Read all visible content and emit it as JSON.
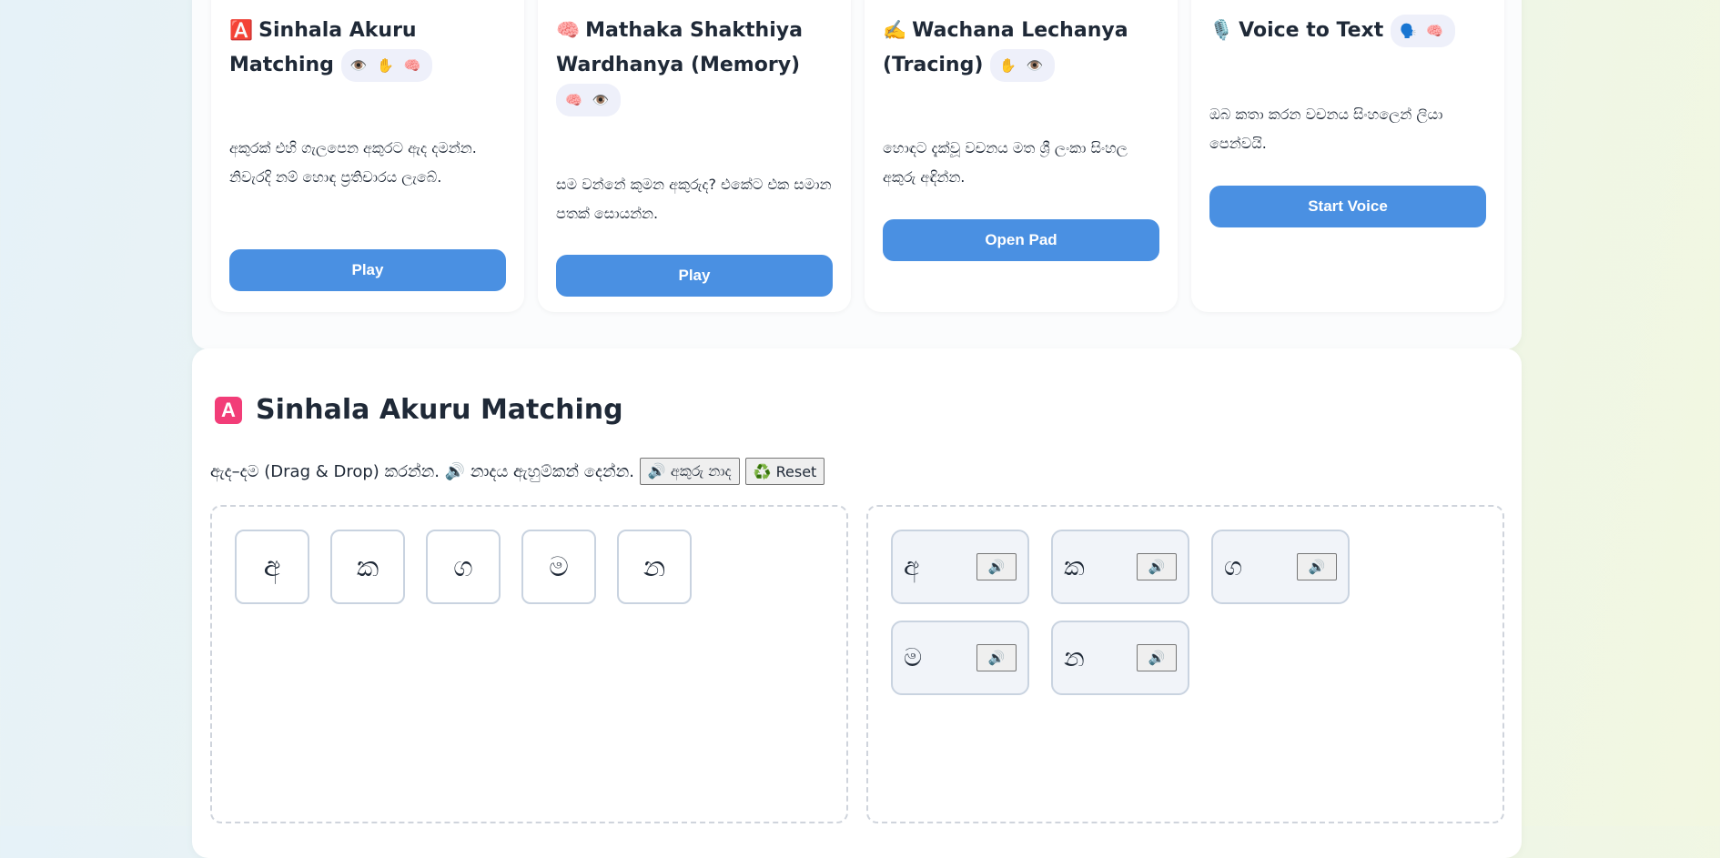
{
  "colors": {
    "accent": "#4a90e2",
    "badge_pink": "#f23d78",
    "tag_bg": "#eef0fa"
  },
  "cards": [
    {
      "icon": "🅰️",
      "title": "Sinhala Akuru Matching",
      "tags": "👁️ ✋ 🧠",
      "description": "අකුරක් එහි ගැලපෙන අකුරට ඇද දමන්න. නිවැරදි නම් හොඳ ප්‍රතිචාරය ලැබේ.",
      "button": "Play"
    },
    {
      "icon": "🧠",
      "title": "Mathaka Shakthiya Wardhanya (Memory)",
      "tags": "🧠 👁️",
      "description": "සම වන්නේ කුමන අකුරුද? එකේට එක සමාන පතක් සොයන්න.",
      "button": "Play"
    },
    {
      "icon": "✍️",
      "title": "Wachana Lechanya (Tracing)",
      "tags": "✋ 👁️",
      "description": "හොඳට දැක්වූ වචනය මත ශ්‍රී ලංකා සිංහල අකුරු අඳින්න.",
      "button": "Open Pad"
    },
    {
      "icon": "🎙️",
      "title": "Voice to Text",
      "tags": "🗣️ 🧠",
      "description": "ඔබ කතා කරන වචනය සිංහලෙන් ලියා පෙන්වයි.",
      "button": "Start Voice"
    }
  ],
  "game": {
    "badge": "A",
    "title": "Sinhala Akuru Matching",
    "instructions": "ඇද–දම (Drag & Drop) කරන්න. 🔊 නාදය ඇහුම්කන් දෙන්න.",
    "sound_button": "🔊 අකුරු නාද",
    "reset_button": "♻️ Reset",
    "source_letters": [
      "අ",
      "ක",
      "ග",
      "ම",
      "න"
    ],
    "targets": [
      {
        "letter": "අ",
        "sound_icon": "🔊"
      },
      {
        "letter": "ක",
        "sound_icon": "🔊"
      },
      {
        "letter": "ග",
        "sound_icon": "🔊"
      },
      {
        "letter": "ම",
        "sound_icon": "🔊"
      },
      {
        "letter": "න",
        "sound_icon": "🔊"
      }
    ]
  }
}
